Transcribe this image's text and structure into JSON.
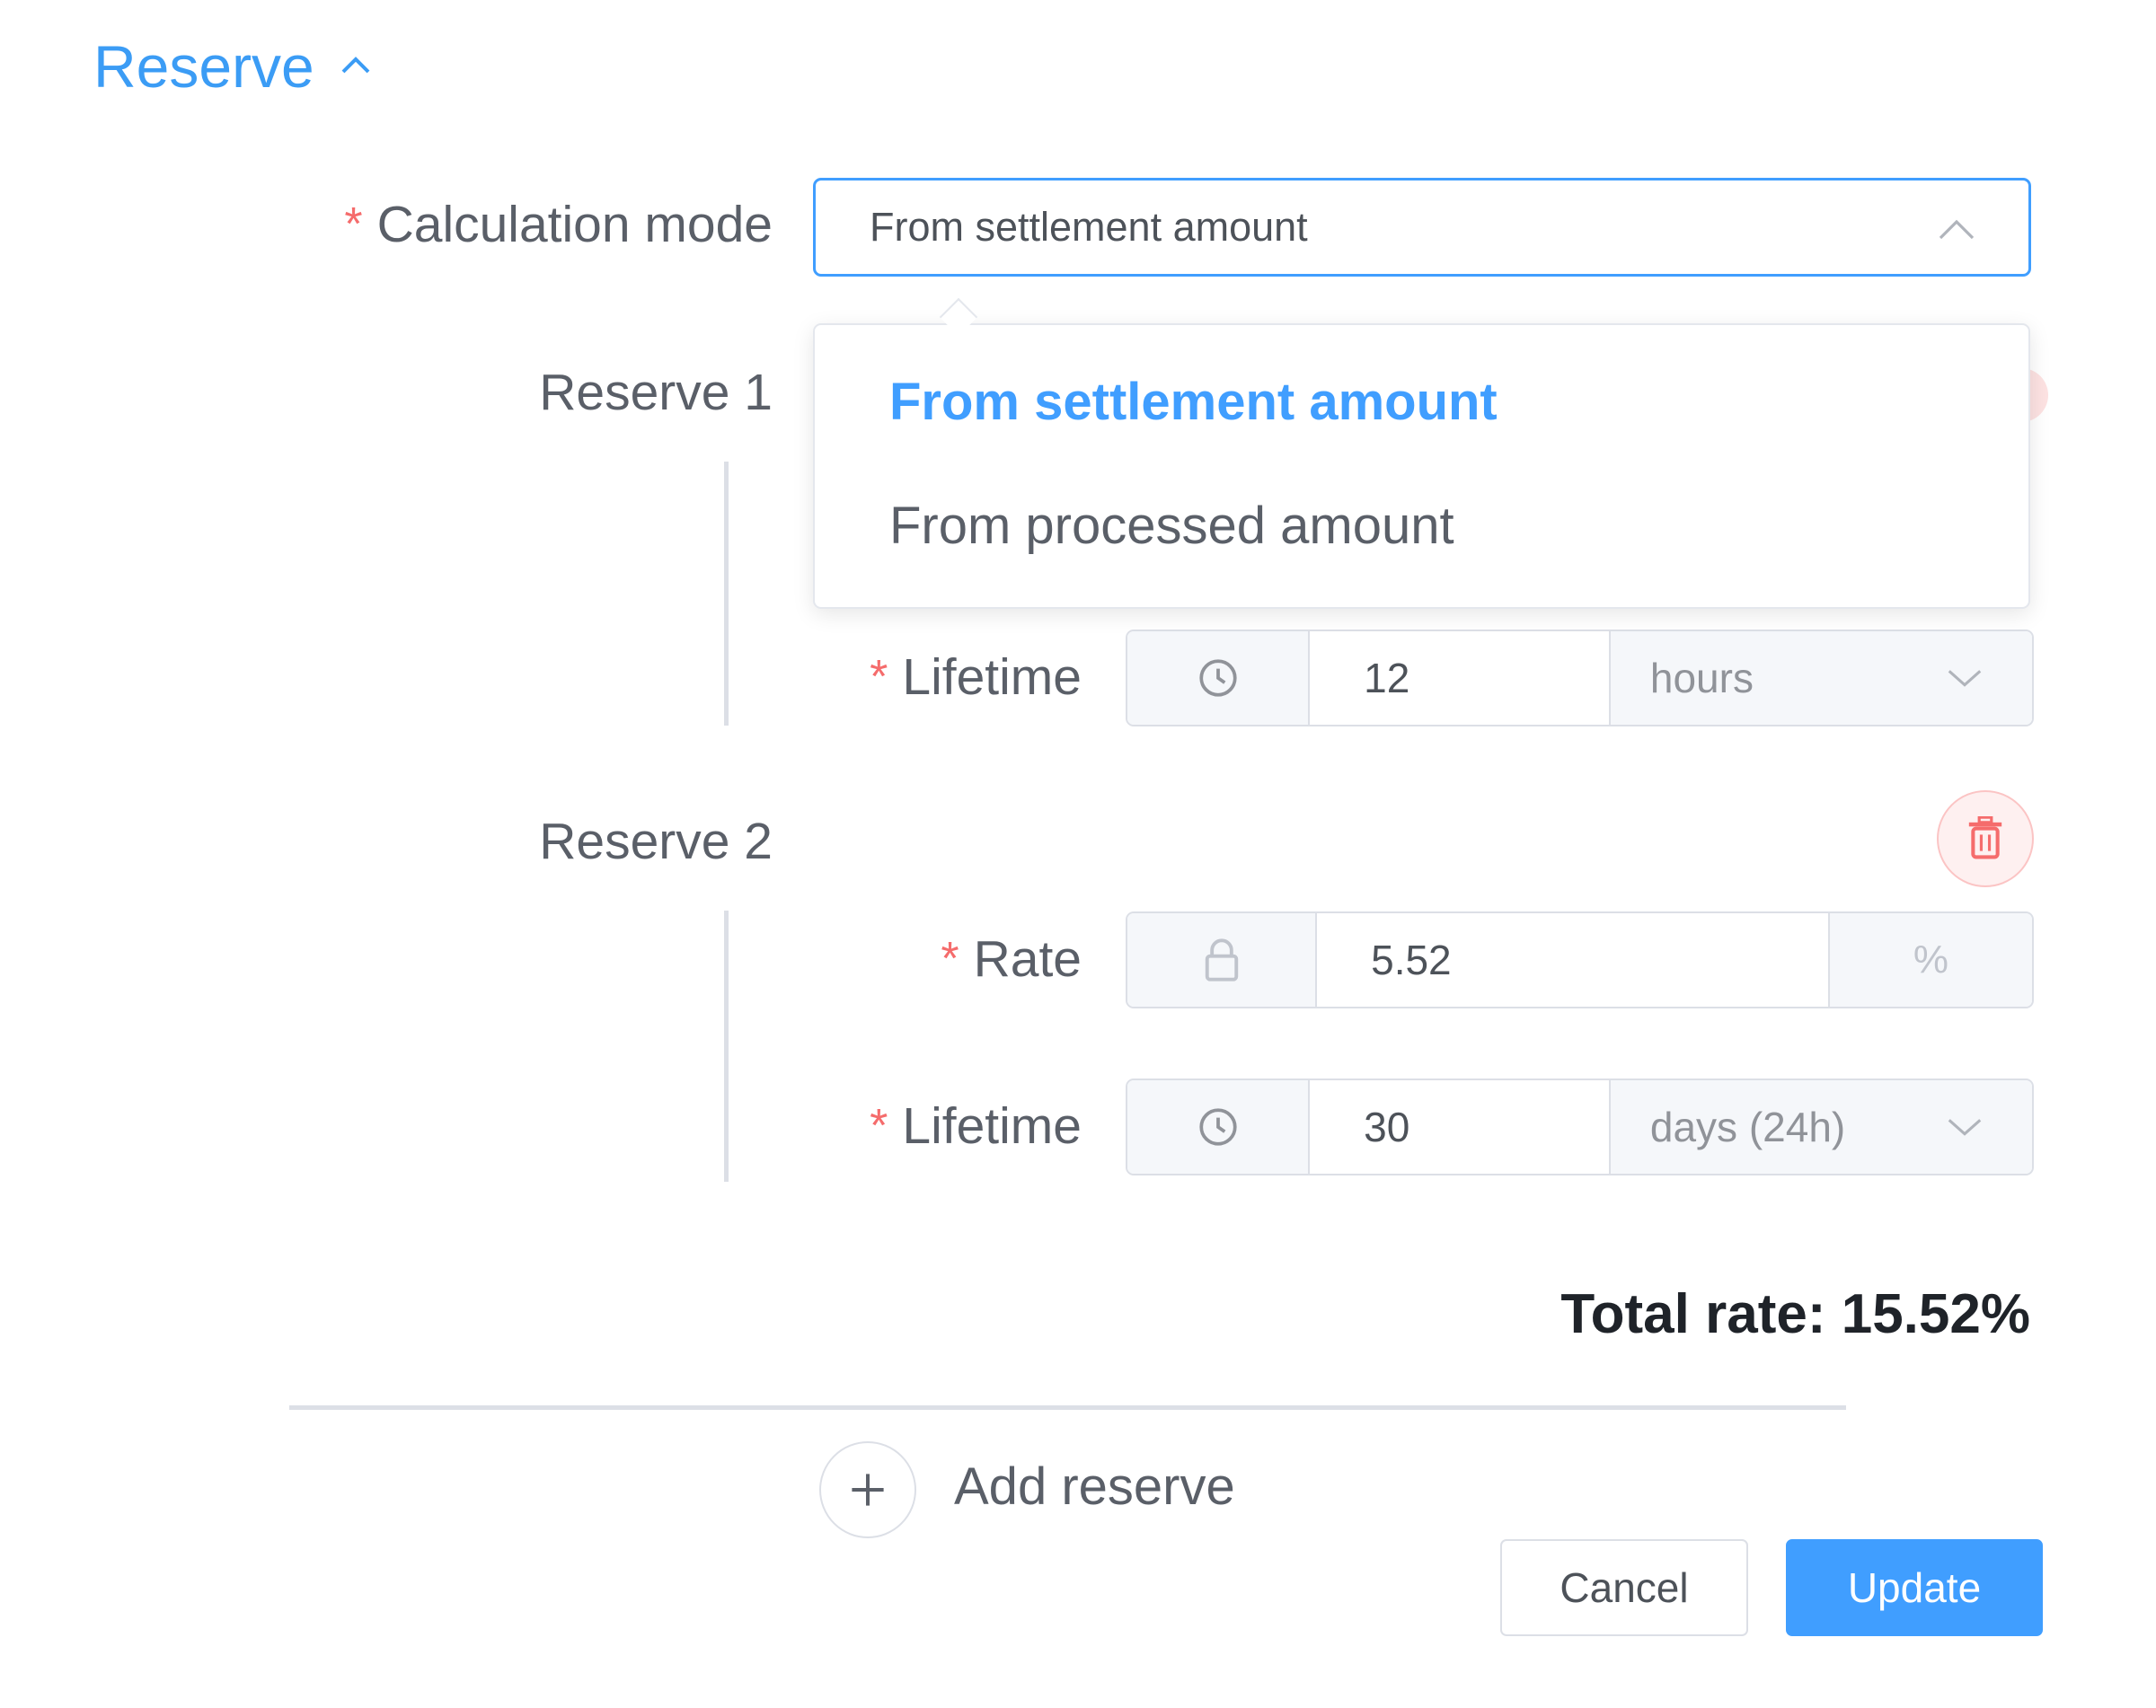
{
  "section": {
    "title": "Reserve"
  },
  "calculation_mode": {
    "required_mark": "*",
    "label": "Calculation mode",
    "value": "From settlement amount",
    "options": [
      "From settlement amount",
      "From processed amount"
    ]
  },
  "reserves": [
    {
      "label": "Reserve 1",
      "lifetime": {
        "required_mark": "*",
        "label": "Lifetime",
        "value": "12",
        "unit": "hours"
      }
    },
    {
      "label": "Reserve 2",
      "rate": {
        "required_mark": "*",
        "label": "Rate",
        "value": "5.52",
        "unit_symbol": "%"
      },
      "lifetime": {
        "required_mark": "*",
        "label": "Lifetime",
        "value": "30",
        "unit": "days (24h)"
      }
    }
  ],
  "summary": {
    "total_rate": "Total rate: 15.52%"
  },
  "actions": {
    "add_reserve": "Add reserve",
    "cancel": "Cancel",
    "update": "Update"
  },
  "colors": {
    "accent": "#409eff",
    "danger": "#f56c6c"
  }
}
